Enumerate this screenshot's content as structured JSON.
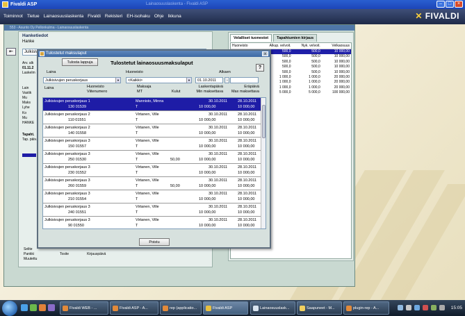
{
  "window": {
    "title": "Fivaldi ASP",
    "faded_caption": "Lainaosuuslaskenta - Fivaldi ASP"
  },
  "menu": [
    "Toiminnot",
    "Tietue",
    "Lainaosuuslaskenta",
    "Fivaldi",
    "Rekisteri",
    "EH-isohaku",
    "Ohje",
    "Ikkuna"
  ],
  "brand": {
    "text_left": "FIVALDI",
    "accent": "#ffd23c"
  },
  "main": {
    "window_title": "553 - Asunto Oy Pellonkulma - Lainaosuuslaskenta",
    "left_panel": {
      "header": "Hanketiedot",
      "sub": "Hanke",
      "field_value": "Julkisivujen"
    },
    "side_labels": [
      "Arv. alk",
      "01.11.2",
      "Laskelm",
      "Lain",
      "Vastik",
      "Mu",
      "Maks",
      "Lyhe",
      "Ko",
      "Mu",
      "HANKE",
      "Tapaht.",
      "Tap. päiv."
    ],
    "bottom_labels": [
      "Selite",
      "Pankki",
      "Muutettu"
    ],
    "bottom_cols": [
      "Tosite",
      "Kirjauspäivä"
    ]
  },
  "right_panel": {
    "tabs": [
      "Velalliset tuonestot",
      "Tapahtumien kirjaus"
    ],
    "columns": [
      "Huoneisto",
      "Alkup. velvoit.",
      "Nyk. velvoit.",
      "Velkaosuus"
    ],
    "rows": [
      [
        "",
        "500,0",
        "500,0",
        "10 000,00"
      ],
      [
        "",
        "500,0",
        "500,0",
        "10 000,00"
      ],
      [
        "",
        "500,0",
        "500,0",
        "10 000,00"
      ],
      [
        "",
        "500,0",
        "500,0",
        "10 000,00"
      ],
      [
        "",
        "500,0",
        "500,0",
        "10 000,00"
      ],
      [
        "",
        "1 000,0",
        "1 000,0",
        "20 000,00"
      ],
      [
        "",
        "1 000,0",
        "1 000,0",
        "20 000,00"
      ],
      [
        "",
        "1 000,0",
        "1 000,0",
        "20 000,00"
      ],
      [
        "",
        "5 000,0",
        "5 000,0",
        "100 000,00"
      ]
    ]
  },
  "dialog": {
    "title": "Tulostetut maksulaput",
    "print_button": "Tulosta lappuja",
    "heading": "Tulostetut lainaosuusmaksulaput",
    "help": "?",
    "close_x": "x",
    "filter_labels": {
      "laina": "Laina",
      "huoneisto": "Huoneisto",
      "alkaen": "Alkaen"
    },
    "filter_values": {
      "laina": "Julkisivujen peruskorjaus",
      "huoneisto": "<Kaikki>",
      "alkaen": "01.10.2011",
      "to": "-"
    },
    "headers": {
      "laina": "Laina",
      "huoneisto": "Huoneisto",
      "viitenumero": "Viitenumero",
      "maksaja": "Maksaja",
      "mt": "MT",
      "kulut": "Kulut",
      "laskentapaiva": "Laskentapäivä",
      "min_maksettava": "Min maksettava",
      "erapaiva": "Eräpäivä",
      "max_maksettava": "Max maksettava"
    },
    "items": [
      {
        "laina": "Julkisivujen peruskorjaus 1",
        "viite": "130 01539",
        "maksaja": "Mannisto, Minna",
        "mt": "T",
        "kulut": "",
        "laskenta": "30.10.2011",
        "min": "10 000,00",
        "era": "28.10.2011",
        "max": "10 000,00",
        "selected": true
      },
      {
        "laina": "Julkisivujen peruskorjaus 2",
        "viite": "110 01551",
        "maksaja": "Virtanen, Ville",
        "mt": "T",
        "kulut": "",
        "laskenta": "30.10.2011",
        "min": "10 000,00",
        "era": "28.10.2011",
        "max": "10 000,00",
        "selected": false
      },
      {
        "laina": "Julkisivujen peruskorjaus 2",
        "viite": "140 01558",
        "maksaja": "Virtanen, Ville",
        "mt": "T",
        "kulut": "",
        "laskenta": "30.10.2011",
        "min": "10 000,00",
        "era": "28.10.2011",
        "max": "10 000,00",
        "selected": false
      },
      {
        "laina": "Julkisivujen peruskorjaus 3",
        "viite": "150 01557",
        "maksaja": "Virtanen, Ville",
        "mt": "T",
        "kulut": "",
        "laskenta": "30.10.2011",
        "min": "10 000,00",
        "era": "28.10.2011",
        "max": "10 000,00",
        "selected": false
      },
      {
        "laina": "Julkisivujen peruskorjaus 3",
        "viite": "250 01530",
        "maksaja": "Virtanen, Ville",
        "mt": "T",
        "kulut": "50,00",
        "laskenta": "30.10.2011",
        "min": "10 000,00",
        "era": "28.10.2011",
        "max": "10 000,00",
        "selected": false
      },
      {
        "laina": "Julkisivujen peruskorjaus 3",
        "viite": "230 01552",
        "maksaja": "Virtanen, Ville",
        "mt": "T",
        "kulut": "",
        "laskenta": "30.10.2011",
        "min": "10 000,00",
        "era": "28.10.2011",
        "max": "10 000,00",
        "selected": false
      },
      {
        "laina": "Julkisivujen peruskorjaus 3",
        "viite": "260 01559",
        "maksaja": "Virtanen, Ville",
        "mt": "T",
        "kulut": "50,00",
        "laskenta": "30.10.2011",
        "min": "10 000,00",
        "era": "28.10.2011",
        "max": "10 000,00",
        "selected": false
      },
      {
        "laina": "Julkisivujen peruskorjaus 3",
        "viite": "210 01554",
        "maksaja": "Virtanen, Ville",
        "mt": "T",
        "kulut": "",
        "laskenta": "30.10.2011",
        "min": "10 000,00",
        "era": "28.10.2011",
        "max": "10 000,00",
        "selected": false
      },
      {
        "laina": "Julkisivujen peruskorjaus 3",
        "viite": "240 01551",
        "maksaja": "Virtanen, Ville",
        "mt": "T",
        "kulut": "",
        "laskenta": "30.10.2011",
        "min": "10 000,00",
        "era": "28.10.2011",
        "max": "10 000,00",
        "selected": false
      },
      {
        "laina": "Julkisivujen peruskorjaus 3",
        "viite": "90 01550",
        "maksaja": "Virtanen, Ville",
        "mt": "T",
        "kulut": "",
        "laskenta": "30.10.2011",
        "min": "10 000,00",
        "era": "28.10.2011",
        "max": "10 000,00",
        "selected": false
      }
    ],
    "close_button": "Poistu"
  },
  "taskbar": {
    "buttons": [
      "Fivaldi WEB - ...",
      "Fivaldi ASP - A...",
      "rep (applicatio...",
      "Fivaldi ASP",
      "Lainaosuuslask...",
      "Saapuneet - M...",
      "plugin-rep - A..."
    ],
    "active_index": 3,
    "clock": "15:05"
  }
}
